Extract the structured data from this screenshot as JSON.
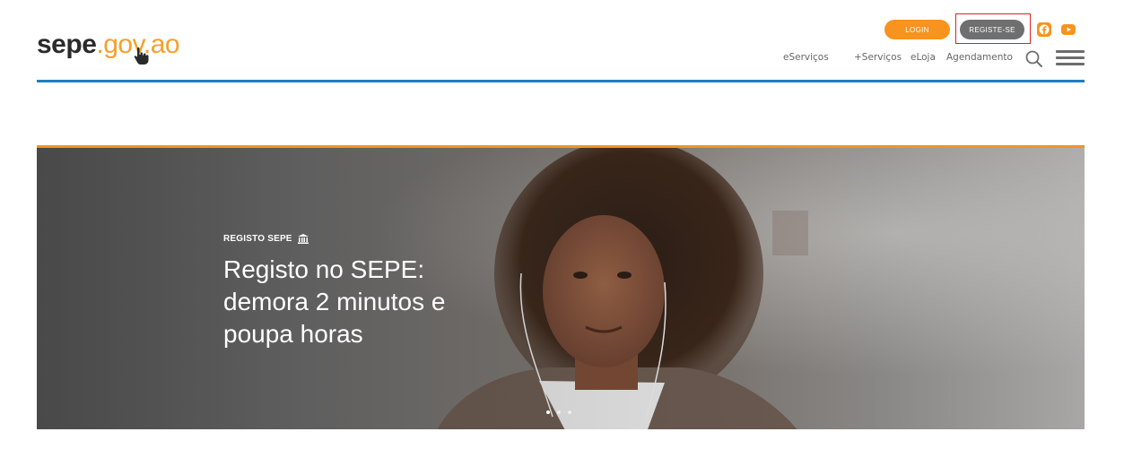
{
  "header": {
    "logo_brand": "sepe",
    "logo_tld": ".gov.ao",
    "login_label": "LOGIN",
    "register_label": "REGISTE-SE",
    "social": [
      "facebook-icon",
      "youtube-icon"
    ],
    "nav": [
      {
        "label": "eServiços"
      },
      {
        "label": "+Serviços"
      },
      {
        "label": "eLoja"
      },
      {
        "label": "Agendamento"
      }
    ]
  },
  "hero": {
    "kicker": "REGISTO SEPE",
    "title": "Registo no SEPE: demora 2 minutos e poupa horas",
    "slides_total": 3,
    "active_slide": 1
  },
  "colors": {
    "accent_orange": "#f7931e",
    "brand_blue": "#1f7ec2",
    "button_gray": "#6f6f70",
    "highlight_red": "#e02020"
  }
}
